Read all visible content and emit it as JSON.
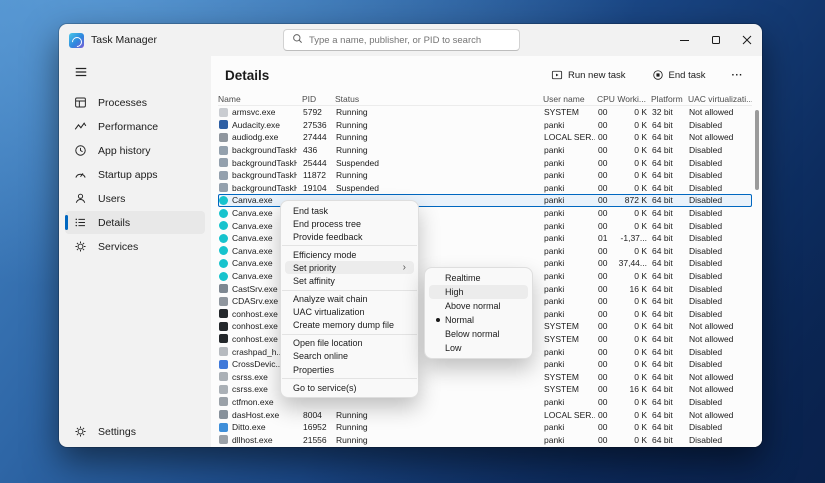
{
  "colors": {
    "accent": "#0067c0",
    "selected_row_bg": "#e9f2fb",
    "selected_row_border": "#0067c0",
    "window_bg": "#f2f2f2",
    "menu_bg": "#f9f9f9"
  },
  "window": {
    "title": "Task Manager",
    "search_placeholder": "Type a name, publisher, or PID to search"
  },
  "sidebar": {
    "items": [
      {
        "label": "Processes",
        "icon": "processes-icon"
      },
      {
        "label": "Performance",
        "icon": "performance-icon"
      },
      {
        "label": "App history",
        "icon": "app-history-icon"
      },
      {
        "label": "Startup apps",
        "icon": "startup-apps-icon"
      },
      {
        "label": "Users",
        "icon": "users-icon"
      },
      {
        "label": "Details",
        "icon": "details-icon",
        "selected": true
      },
      {
        "label": "Services",
        "icon": "services-icon"
      }
    ],
    "settings": {
      "label": "Settings",
      "icon": "settings-icon"
    }
  },
  "header": {
    "title": "Details",
    "run_new_task": "Run new task",
    "end_task": "End task",
    "more": "···"
  },
  "table": {
    "columns": [
      "Name",
      "PID",
      "Status",
      "User name",
      "CPU",
      "Worki...",
      "Platform",
      "UAC virtualizati..."
    ],
    "rows": [
      {
        "name": "armsvc.exe",
        "pid": "5792",
        "status": "Running",
        "user": "SYSTEM",
        "cpu": "00",
        "working_set": "0 K",
        "platform": "32 bit",
        "uac": "Not allowed",
        "icon_color": "#c9ccd1",
        "icon_shape": "square"
      },
      {
        "name": "Audacity.exe",
        "pid": "27536",
        "status": "Running",
        "user": "panki",
        "cpu": "00",
        "working_set": "0 K",
        "platform": "64 bit",
        "uac": "Disabled",
        "icon_color": "#2e5fa3",
        "icon_shape": "square"
      },
      {
        "name": "audiodg.exe",
        "pid": "27444",
        "status": "Running",
        "user": "LOCAL SER...",
        "cpu": "00",
        "working_set": "0 K",
        "platform": "64 bit",
        "uac": "Not allowed",
        "icon_color": "#8f969e",
        "icon_shape": "square"
      },
      {
        "name": "backgroundTaskHost...",
        "pid": "436",
        "status": "Running",
        "user": "panki",
        "cpu": "00",
        "working_set": "0 K",
        "platform": "64 bit",
        "uac": "Disabled",
        "icon_color": "#93a0ad",
        "icon_shape": "square"
      },
      {
        "name": "backgroundTaskHost...",
        "pid": "25444",
        "status": "Suspended",
        "user": "panki",
        "cpu": "00",
        "working_set": "0 K",
        "platform": "64 bit",
        "uac": "Disabled",
        "icon_color": "#93a0ad",
        "icon_shape": "square"
      },
      {
        "name": "backgroundTaskHost...",
        "pid": "11872",
        "status": "Running",
        "user": "panki",
        "cpu": "00",
        "working_set": "0 K",
        "platform": "64 bit",
        "uac": "Disabled",
        "icon_color": "#93a0ad",
        "icon_shape": "square"
      },
      {
        "name": "backgroundTaskHost...",
        "pid": "19104",
        "status": "Suspended",
        "user": "panki",
        "cpu": "00",
        "working_set": "0 K",
        "platform": "64 bit",
        "uac": "Disabled",
        "icon_color": "#93a0ad",
        "icon_shape": "square"
      },
      {
        "name": "Canva.exe",
        "pid": "",
        "status": "",
        "user": "panki",
        "cpu": "00",
        "working_set": "872 K",
        "platform": "64 bit",
        "uac": "Disabled",
        "icon_color": "#17c3cd",
        "icon_shape": "circle",
        "selected": true
      },
      {
        "name": "Canva.exe",
        "pid": "",
        "status": "",
        "user": "panki",
        "cpu": "00",
        "working_set": "0 K",
        "platform": "64 bit",
        "uac": "Disabled",
        "icon_color": "#17c3cd",
        "icon_shape": "circle"
      },
      {
        "name": "Canva.exe",
        "pid": "",
        "status": "",
        "user": "panki",
        "cpu": "00",
        "working_set": "0 K",
        "platform": "64 bit",
        "uac": "Disabled",
        "icon_color": "#17c3cd",
        "icon_shape": "circle"
      },
      {
        "name": "Canva.exe",
        "pid": "",
        "status": "",
        "user": "panki",
        "cpu": "01",
        "working_set": "-1,37...",
        "platform": "64 bit",
        "uac": "Disabled",
        "icon_color": "#17c3cd",
        "icon_shape": "circle"
      },
      {
        "name": "Canva.exe",
        "pid": "",
        "status": "",
        "user": "panki",
        "cpu": "00",
        "working_set": "0 K",
        "platform": "64 bit",
        "uac": "Disabled",
        "icon_color": "#17c3cd",
        "icon_shape": "circle"
      },
      {
        "name": "Canva.exe",
        "pid": "",
        "status": "",
        "user": "panki",
        "cpu": "00",
        "working_set": "37,44...",
        "platform": "64 bit",
        "uac": "Disabled",
        "icon_color": "#17c3cd",
        "icon_shape": "circle"
      },
      {
        "name": "Canva.exe",
        "pid": "",
        "status": "",
        "user": "panki",
        "cpu": "00",
        "working_set": "0 K",
        "platform": "64 bit",
        "uac": "Disabled",
        "icon_color": "#17c3cd",
        "icon_shape": "circle"
      },
      {
        "name": "CastSrv.exe",
        "pid": "",
        "status": "",
        "user": "panki",
        "cpu": "00",
        "working_set": "16 K",
        "platform": "64 bit",
        "uac": "Disabled",
        "icon_color": "#7d8791",
        "icon_shape": "square"
      },
      {
        "name": "CDASrv.exe",
        "pid": "",
        "status": "",
        "user": "panki",
        "cpu": "00",
        "working_set": "0 K",
        "platform": "64 bit",
        "uac": "Disabled",
        "icon_color": "#8f969e",
        "icon_shape": "square"
      },
      {
        "name": "conhost.exe",
        "pid": "",
        "status": "",
        "user": "panki",
        "cpu": "00",
        "working_set": "0 K",
        "platform": "64 bit",
        "uac": "Disabled",
        "icon_color": "#23272b",
        "icon_shape": "square"
      },
      {
        "name": "conhost.exe",
        "pid": "",
        "status": "",
        "user": "SYSTEM",
        "cpu": "00",
        "working_set": "0 K",
        "platform": "64 bit",
        "uac": "Not allowed",
        "icon_color": "#23272b",
        "icon_shape": "square"
      },
      {
        "name": "conhost.exe",
        "pid": "",
        "status": "",
        "user": "SYSTEM",
        "cpu": "00",
        "working_set": "0 K",
        "platform": "64 bit",
        "uac": "Not allowed",
        "icon_color": "#23272b",
        "icon_shape": "square"
      },
      {
        "name": "crashpad_h...",
        "pid": "",
        "status": "",
        "user": "panki",
        "cpu": "00",
        "working_set": "0 K",
        "platform": "64 bit",
        "uac": "Disabled",
        "icon_color": "#b6babf",
        "icon_shape": "square"
      },
      {
        "name": "CrossDevic...",
        "pid": "",
        "status": "",
        "user": "panki",
        "cpu": "00",
        "working_set": "0 K",
        "platform": "64 bit",
        "uac": "Disabled",
        "icon_color": "#3f79d9",
        "icon_shape": "square"
      },
      {
        "name": "csrss.exe",
        "pid": "",
        "status": "",
        "user": "SYSTEM",
        "cpu": "00",
        "working_set": "0 K",
        "platform": "64 bit",
        "uac": "Not allowed",
        "icon_color": "#aab0b6",
        "icon_shape": "square"
      },
      {
        "name": "csrss.exe",
        "pid": "",
        "status": "",
        "user": "SYSTEM",
        "cpu": "00",
        "working_set": "16 K",
        "platform": "64 bit",
        "uac": "Not allowed",
        "icon_color": "#aab0b6",
        "icon_shape": "square"
      },
      {
        "name": "ctfmon.exe",
        "pid": "",
        "status": "",
        "user": "panki",
        "cpu": "00",
        "working_set": "0 K",
        "platform": "64 bit",
        "uac": "Disabled",
        "icon_color": "#9aa1a8",
        "icon_shape": "square"
      },
      {
        "name": "dasHost.exe",
        "pid": "8004",
        "status": "Running",
        "user": "LOCAL SER...",
        "cpu": "00",
        "working_set": "0 K",
        "platform": "64 bit",
        "uac": "Not allowed",
        "icon_color": "#87919b",
        "icon_shape": "square"
      },
      {
        "name": "Ditto.exe",
        "pid": "16952",
        "status": "Running",
        "user": "panki",
        "cpu": "00",
        "working_set": "0 K",
        "platform": "64 bit",
        "uac": "Disabled",
        "icon_color": "#3f8fd9",
        "icon_shape": "square"
      },
      {
        "name": "dllhost.exe",
        "pid": "21556",
        "status": "Running",
        "user": "panki",
        "cpu": "00",
        "working_set": "0 K",
        "platform": "64 bit",
        "uac": "Disabled",
        "icon_color": "#9aa1a8",
        "icon_shape": "square"
      }
    ]
  },
  "context_menu": {
    "items": [
      {
        "label": "End task"
      },
      {
        "label": "End process tree"
      },
      {
        "label": "Provide feedback"
      },
      {
        "type": "separator"
      },
      {
        "label": "Efficiency mode"
      },
      {
        "label": "Set priority",
        "submenu": true,
        "highlighted": true
      },
      {
        "label": "Set affinity"
      },
      {
        "type": "separator"
      },
      {
        "label": "Analyze wait chain"
      },
      {
        "label": "UAC virtualization"
      },
      {
        "label": "Create memory dump file"
      },
      {
        "type": "separator"
      },
      {
        "label": "Open file location"
      },
      {
        "label": "Search online"
      },
      {
        "label": "Properties"
      },
      {
        "type": "separator"
      },
      {
        "label": "Go to service(s)"
      }
    ]
  },
  "priority_submenu": {
    "items": [
      {
        "label": "Realtime"
      },
      {
        "label": "High",
        "highlighted": true
      },
      {
        "label": "Above normal"
      },
      {
        "label": "Normal",
        "checked": true
      },
      {
        "label": "Below normal"
      },
      {
        "label": "Low"
      }
    ]
  }
}
